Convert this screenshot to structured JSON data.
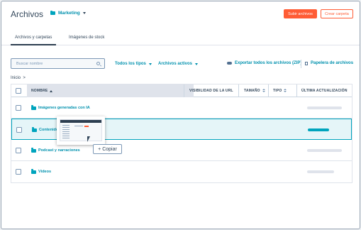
{
  "header": {
    "title": "Archivos",
    "folder_selector": "Marketing",
    "primary_button": "Subir archivos",
    "secondary_button": "Crear carpeta"
  },
  "tabs": [
    {
      "label": "Archivos y carpetas",
      "active": true
    },
    {
      "label": "Imágenes de stock",
      "active": false
    }
  ],
  "toolbar": {
    "search_placeholder": "Buscar nombre",
    "filter_types": "Todos los tipos",
    "filter_status": "Archivos activos",
    "export_label": "Exportar todos los archivos (ZIP)",
    "trash_label": "Papelera de archivos"
  },
  "breadcrumb": "Inicio",
  "table": {
    "columns": [
      "NOMBRE",
      "VISIBILIDAD DE LA URL",
      "TAMAÑO",
      "TIPO",
      "ÚLTIMA ACTUALIZACIÓN"
    ],
    "rows": [
      {
        "name": "Imágenes generadas con IA",
        "selected": false
      },
      {
        "name": "Contenido g",
        "selected": true
      },
      {
        "name": "Podcast y narraciones",
        "selected": false
      },
      {
        "name": "Vídeos",
        "selected": false
      }
    ]
  },
  "drag": {
    "action_label": "+ Copiar"
  },
  "colors": {
    "accent": "#ff5c35",
    "link": "#0091ae",
    "selected_row_bg": "#e5f5f8",
    "selected_row_border": "#00a4bd"
  },
  "icons": [
    "folder-icon",
    "search-icon",
    "caret-down-icon",
    "cloud-download-icon",
    "trash-icon",
    "sort-icon",
    "cursor-icon"
  ]
}
